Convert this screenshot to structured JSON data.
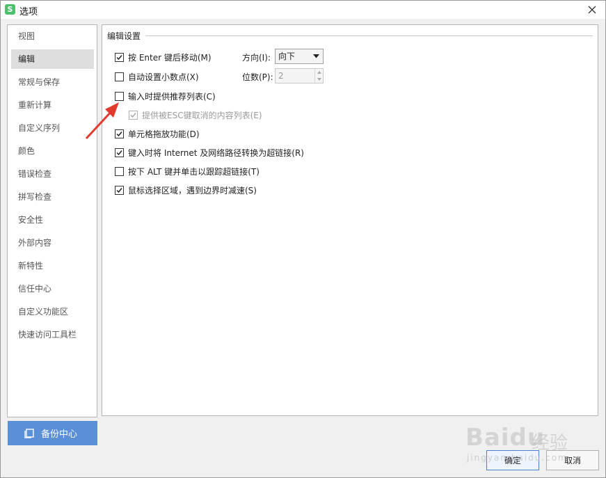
{
  "window": {
    "title": "选项",
    "app_icon_letter": "S",
    "close_icon": "close-icon"
  },
  "sidebar": {
    "items": [
      {
        "label": "视图"
      },
      {
        "label": "编辑",
        "active": true
      },
      {
        "label": "常规与保存"
      },
      {
        "label": "重新计算"
      },
      {
        "label": "自定义序列"
      },
      {
        "label": "颜色"
      },
      {
        "label": "错误检查"
      },
      {
        "label": "拼写检查"
      },
      {
        "label": "安全性"
      },
      {
        "label": "外部内容"
      },
      {
        "label": "新特性"
      },
      {
        "label": "信任中心"
      },
      {
        "label": "自定义功能区"
      },
      {
        "label": "快速访问工具栏"
      }
    ],
    "backup_button": "备份中心"
  },
  "main": {
    "section_title": "编辑设置",
    "options": [
      {
        "label": "按 Enter 键后移动(M)",
        "checked": true,
        "disabled": false
      },
      {
        "label": "自动设置小数点(X)",
        "checked": false,
        "disabled": false
      },
      {
        "label": "输入时提供推荐列表(C)",
        "checked": false,
        "disabled": false
      },
      {
        "label": "提供被ESC键取消的内容列表(E)",
        "checked": true,
        "disabled": true
      },
      {
        "label": "单元格拖放功能(D)",
        "checked": true,
        "disabled": false
      },
      {
        "label": "键入时将 Internet 及网络路径转换为超链接(R)",
        "checked": true,
        "disabled": false
      },
      {
        "label": "按下 ALT 键并单击以跟踪超链接(T)",
        "checked": false,
        "disabled": false
      },
      {
        "label": "鼠标选择区域，遇到边界时减速(S)",
        "checked": true,
        "disabled": false
      }
    ],
    "direction": {
      "label": "方向(I):",
      "value": "向下"
    },
    "decimals": {
      "label": "位数(P):",
      "value": "2"
    }
  },
  "footer": {
    "ok": "确定",
    "cancel": "取消"
  },
  "watermark": {
    "logo": "Baidu",
    "sub": "经验",
    "url": "jingyan.baidu.com"
  },
  "colors": {
    "accent": "#5b8fd8",
    "annotation": "#e23b2e"
  }
}
